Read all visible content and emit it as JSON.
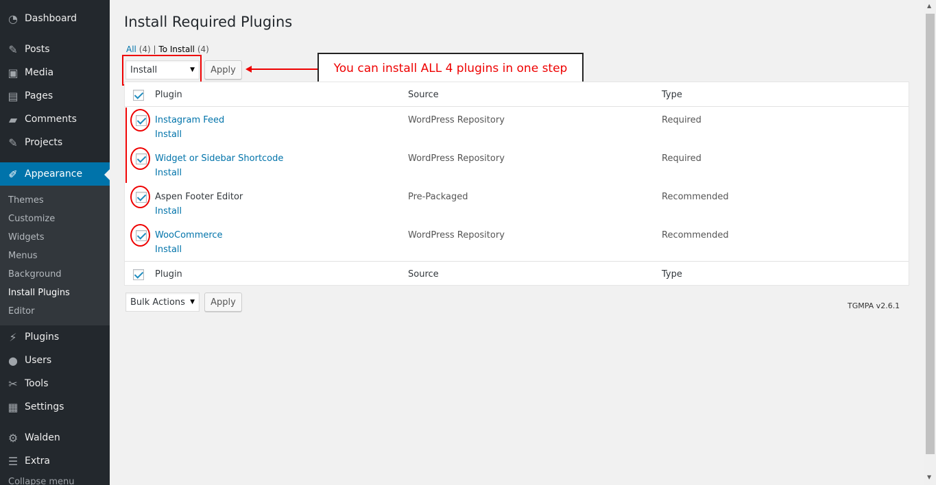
{
  "sidebar": {
    "items": [
      {
        "label": "Dashboard",
        "icon": "dashboard-icon",
        "glyph": "◔"
      },
      {
        "label": "Posts",
        "icon": "pin-icon",
        "glyph": "✎"
      },
      {
        "label": "Media",
        "icon": "media-icon",
        "glyph": "▣"
      },
      {
        "label": "Pages",
        "icon": "pages-icon",
        "glyph": "▤"
      },
      {
        "label": "Comments",
        "icon": "comment-icon",
        "glyph": "▰"
      },
      {
        "label": "Projects",
        "icon": "pin-icon",
        "glyph": "✎"
      },
      {
        "label": "Appearance",
        "icon": "brush-icon",
        "glyph": "✐"
      },
      {
        "label": "Plugins",
        "icon": "plug-icon",
        "glyph": "⚡"
      },
      {
        "label": "Users",
        "icon": "user-icon",
        "glyph": "●"
      },
      {
        "label": "Tools",
        "icon": "wrench-icon",
        "glyph": "✂"
      },
      {
        "label": "Settings",
        "icon": "settings-icon",
        "glyph": "▦"
      },
      {
        "label": "Walden",
        "icon": "gear-icon",
        "glyph": "⚙"
      },
      {
        "label": "Extra",
        "icon": "menu-icon",
        "glyph": "☰"
      }
    ],
    "submenu": [
      "Themes",
      "Customize",
      "Widgets",
      "Menus",
      "Background",
      "Install Plugins",
      "Editor"
    ],
    "collapse_label": "Collapse menu"
  },
  "page": {
    "title": "Install Required Plugins",
    "filters": {
      "all_label": "All",
      "all_count": "(4)",
      "separator": "|",
      "to_install_label": "To Install",
      "to_install_count": "(4)"
    },
    "top_action": {
      "selected": "Install",
      "apply_label": "Apply"
    },
    "bottom_action": {
      "selected": "Bulk Actions",
      "apply_label": "Apply"
    },
    "callout": "You can install ALL 4 plugins in one step",
    "version": "TGMPA v2.6.1"
  },
  "table": {
    "columns": [
      "Plugin",
      "Source",
      "Type"
    ],
    "rows": [
      {
        "name": "Instagram Feed",
        "action": "Install",
        "source": "WordPress Repository",
        "type": "Required"
      },
      {
        "name": "Widget or Sidebar Shortcode",
        "action": "Install",
        "source": "WordPress Repository",
        "type": "Required"
      },
      {
        "name": "Aspen Footer Editor",
        "action": "Install",
        "source": "Pre-Packaged",
        "type": "Recommended"
      },
      {
        "name": "WooCommerce",
        "action": "Install",
        "source": "WordPress Repository",
        "type": "Recommended"
      }
    ]
  },
  "colors": {
    "accent": "#0073aa",
    "annotation": "#e00000",
    "sidebar": "#23282d"
  }
}
